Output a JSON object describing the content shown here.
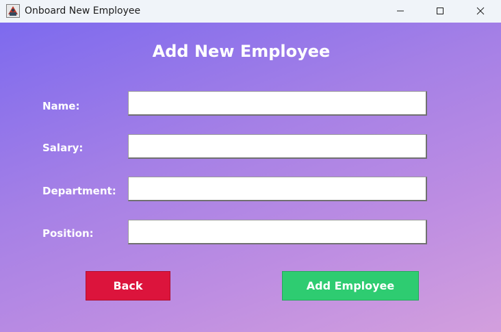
{
  "window": {
    "title": "Onboard New Employee",
    "controls": {
      "minimize": "minimize-icon",
      "maximize": "maximize-icon",
      "close": "close-icon"
    }
  },
  "form": {
    "heading": "Add New Employee",
    "fields": [
      {
        "label": "Name:",
        "value": ""
      },
      {
        "label": "Salary:",
        "value": ""
      },
      {
        "label": "Department:",
        "value": ""
      },
      {
        "label": "Position:",
        "value": ""
      }
    ],
    "back_label": "Back",
    "add_label": "Add Employee"
  },
  "colors": {
    "gradient_start": "#7d6aee",
    "gradient_end": "#d39fdd",
    "back_button": "#dc143c",
    "add_button": "#2ecc71"
  }
}
